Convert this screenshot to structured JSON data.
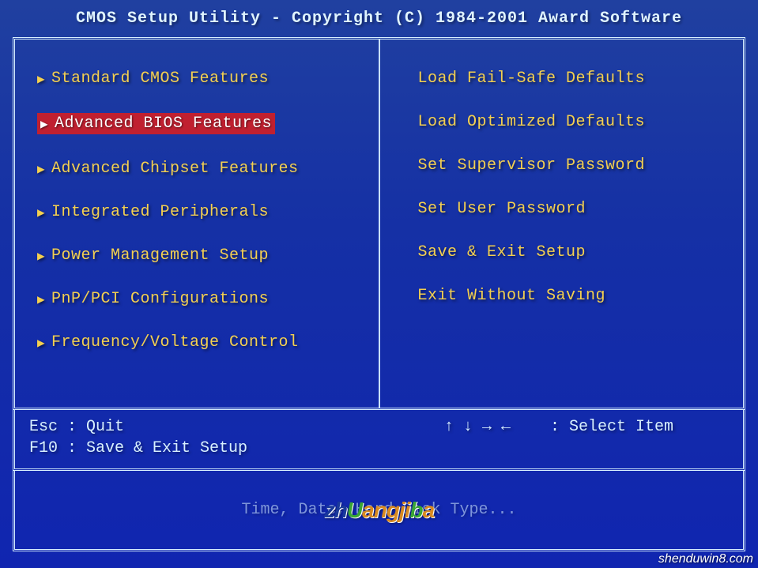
{
  "title": "CMOS Setup Utility - Copyright (C) 1984-2001 Award Software",
  "left_menu": [
    "Standard CMOS Features",
    "Advanced BIOS Features",
    "Advanced Chipset Features",
    "Integrated Peripherals",
    "Power Management Setup",
    "PnP/PCI Configurations",
    "Frequency/Voltage Control"
  ],
  "right_menu": [
    "Load Fail-Safe Defaults",
    "Load Optimized Defaults",
    "Set Supervisor Password",
    "Set User Password",
    "Save & Exit Setup",
    "Exit Without Saving"
  ],
  "selected_index": 1,
  "help": {
    "esc": "Esc : Quit",
    "f10": "F10 : Save & Exit Setup",
    "arrows": "↑ ↓ → ←",
    "select": ": Select Item"
  },
  "status_line": "Time, Date, Hard Disk Type...",
  "watermark": "shenduwin8.com"
}
